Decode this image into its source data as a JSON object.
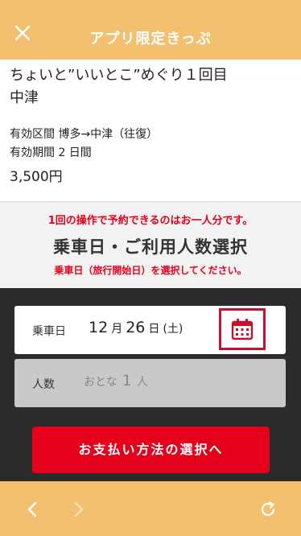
{
  "header": {
    "title": "アプリ限定きっぷ"
  },
  "ticket": {
    "name_line1": "ちょいと”いいとこ”めぐり１回目",
    "name_line2": "中津",
    "section": "有効区間 博多→中津（往復）",
    "period": "有効期間 2 日間",
    "price": "3,500円"
  },
  "notice": {
    "limit": "1回の操作で予約できるのはお一人分です。",
    "heading": "乗車日・ご利用人数選択",
    "instruction": "乗車日（旅行開始日）を選択してください。"
  },
  "form": {
    "date_label": "乗車日",
    "month": "12",
    "month_unit": "月",
    "day": "26",
    "day_unit": "日",
    "weekday": "(土)",
    "people_label": "人数",
    "people_type": "おとな",
    "people_count": "1",
    "people_unit": "人",
    "pay_button": "お支払い方法の選択へ"
  },
  "icons": {
    "close": "close-icon",
    "calendar": "calendar-icon",
    "back": "chevron-left-icon",
    "forward": "chevron-right-icon",
    "reload": "reload-icon"
  },
  "colors": {
    "accent": "#F2C06E",
    "red": "#E5001C",
    "dark": "#2B2B2B"
  }
}
